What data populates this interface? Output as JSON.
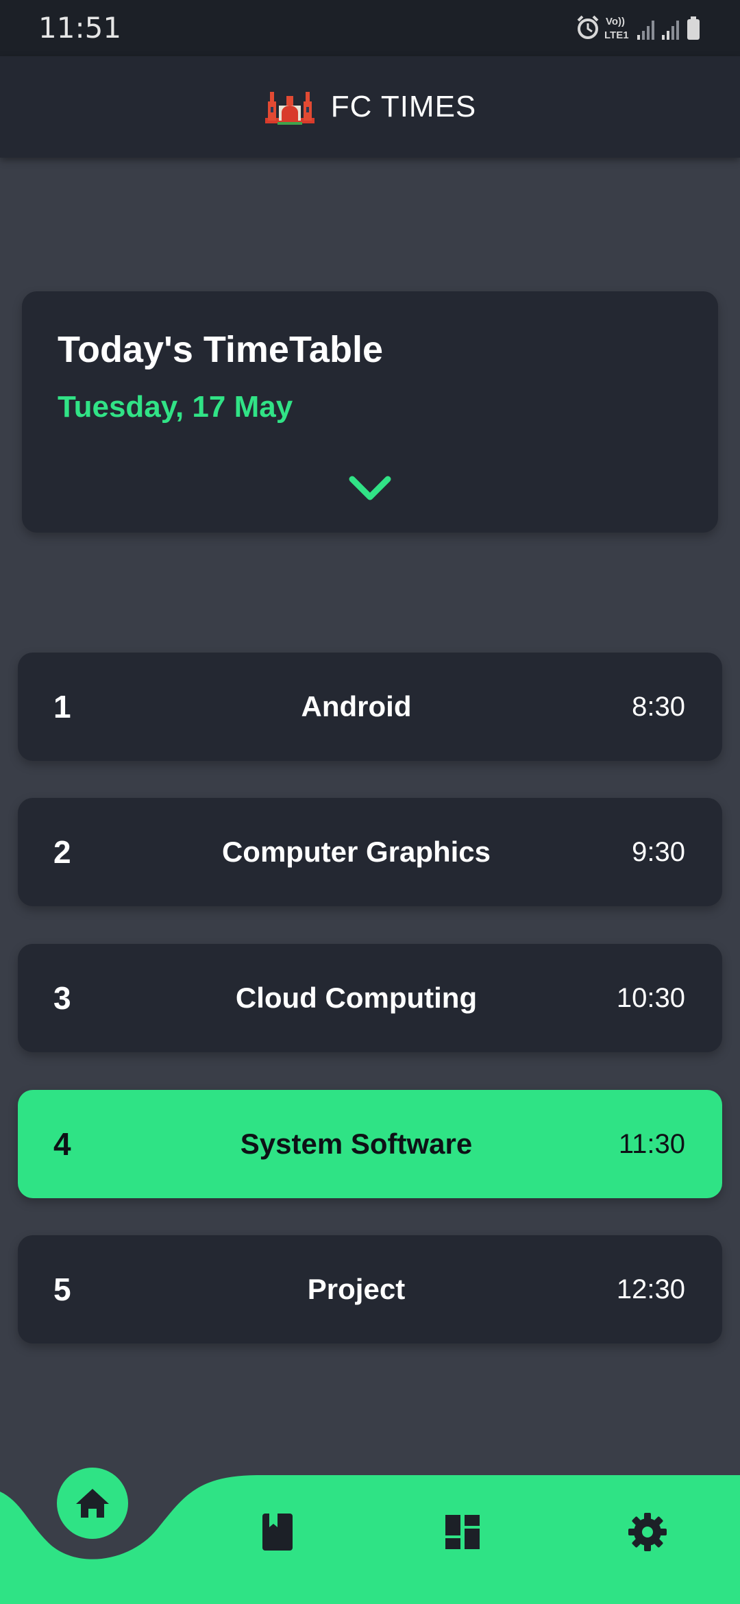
{
  "status_bar": {
    "time": "11:51",
    "icons": [
      "alarm-icon",
      "volte-lte-icon",
      "signal-icon",
      "signal-icon",
      "battery-icon"
    ],
    "volte_label": "Vo))",
    "lte_label": "LTE1"
  },
  "app_bar": {
    "title": "FC TIMES",
    "logo_icon": "college-building-logo"
  },
  "today_card": {
    "title": "Today's TimeTable",
    "date": "Tuesday, 17 May",
    "expand_icon": "chevron-down-icon"
  },
  "periods": [
    {
      "number": "1",
      "subject": "Android",
      "time": "8:30",
      "active": false
    },
    {
      "number": "2",
      "subject": "Computer Graphics",
      "time": "9:30",
      "active": false
    },
    {
      "number": "3",
      "subject": "Cloud Computing",
      "time": "10:30",
      "active": false
    },
    {
      "number": "4",
      "subject": "System Software",
      "time": "11:30",
      "active": true
    },
    {
      "number": "5",
      "subject": "Project",
      "time": "12:30",
      "active": false
    }
  ],
  "bottom_nav": {
    "items": [
      "home-icon",
      "book-icon",
      "dashboard-icon",
      "gear-icon"
    ],
    "selected": "home-icon"
  },
  "colors": {
    "accent": "#2fe385",
    "background": "#3a3e48",
    "card": "#242832",
    "status_bar": "#1c2027"
  }
}
